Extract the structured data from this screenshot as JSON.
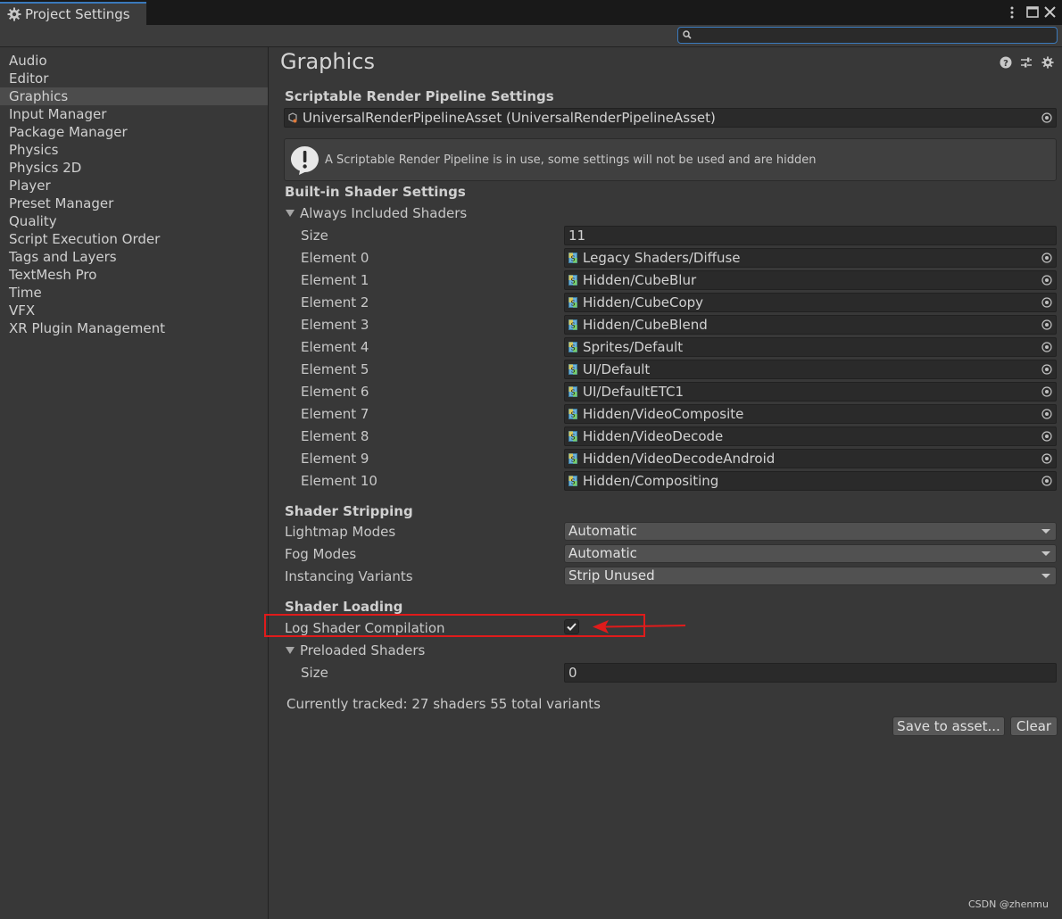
{
  "window": {
    "tab_title": "Project Settings",
    "search": {
      "placeholder": ""
    }
  },
  "sidebar": {
    "items": [
      {
        "label": "Audio",
        "selected": false
      },
      {
        "label": "Editor",
        "selected": false
      },
      {
        "label": "Graphics",
        "selected": true
      },
      {
        "label": "Input Manager",
        "selected": false
      },
      {
        "label": "Package Manager",
        "selected": false
      },
      {
        "label": "Physics",
        "selected": false
      },
      {
        "label": "Physics 2D",
        "selected": false
      },
      {
        "label": "Player",
        "selected": false
      },
      {
        "label": "Preset Manager",
        "selected": false
      },
      {
        "label": "Quality",
        "selected": false
      },
      {
        "label": "Script Execution Order",
        "selected": false
      },
      {
        "label": "Tags and Layers",
        "selected": false
      },
      {
        "label": "TextMesh Pro",
        "selected": false
      },
      {
        "label": "Time",
        "selected": false
      },
      {
        "label": "VFX",
        "selected": false
      },
      {
        "label": "XR Plugin Management",
        "selected": false
      }
    ]
  },
  "main": {
    "title": "Graphics",
    "srp": {
      "heading": "Scriptable Render Pipeline Settings",
      "asset": "UniversalRenderPipelineAsset (UniversalRenderPipelineAsset)",
      "help_message": "A Scriptable Render Pipeline is in use, some settings will not be used and are hidden"
    },
    "builtin": {
      "heading": "Built-in Shader Settings",
      "always_included_label": "Always Included Shaders",
      "size_label": "Size",
      "size_value": "11",
      "elements": [
        {
          "label": "Element 0",
          "value": "Legacy Shaders/Diffuse"
        },
        {
          "label": "Element 1",
          "value": "Hidden/CubeBlur"
        },
        {
          "label": "Element 2",
          "value": "Hidden/CubeCopy"
        },
        {
          "label": "Element 3",
          "value": "Hidden/CubeBlend"
        },
        {
          "label": "Element 4",
          "value": "Sprites/Default"
        },
        {
          "label": "Element 5",
          "value": "UI/Default"
        },
        {
          "label": "Element 6",
          "value": "UI/DefaultETC1"
        },
        {
          "label": "Element 7",
          "value": "Hidden/VideoComposite"
        },
        {
          "label": "Element 8",
          "value": "Hidden/VideoDecode"
        },
        {
          "label": "Element 9",
          "value": "Hidden/VideoDecodeAndroid"
        },
        {
          "label": "Element 10",
          "value": "Hidden/Compositing"
        }
      ]
    },
    "stripping": {
      "heading": "Shader Stripping",
      "rows": [
        {
          "label": "Lightmap Modes",
          "value": "Automatic"
        },
        {
          "label": "Fog Modes",
          "value": "Automatic"
        },
        {
          "label": "Instancing Variants",
          "value": "Strip Unused"
        }
      ]
    },
    "loading": {
      "heading": "Shader Loading",
      "log_label": "Log Shader Compilation",
      "log_checked": true,
      "preloaded_label": "Preloaded Shaders",
      "size_label": "Size",
      "size_value": "0",
      "tracked": "Currently tracked: 27 shaders 55 total variants",
      "save_button": "Save to asset...",
      "clear_button": "Clear"
    }
  },
  "watermark": "CSDN @zhenmu",
  "colors": {
    "accent": "#3a79bb",
    "annotation": "#e01b1b",
    "background": "#383838"
  }
}
